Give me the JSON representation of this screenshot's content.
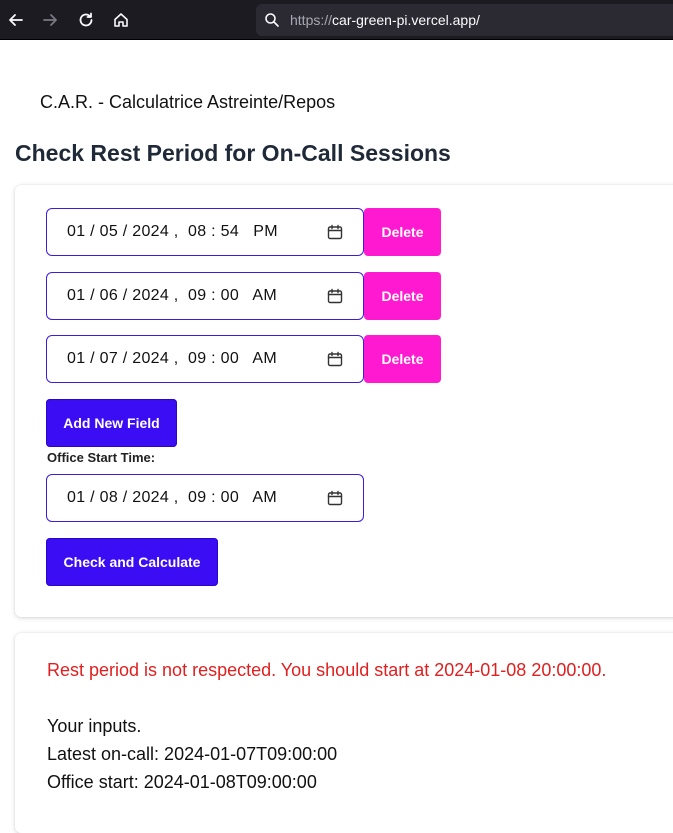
{
  "browser": {
    "url_protocol": "https://",
    "url_host": "car-green-pi.vercel.app/"
  },
  "app": {
    "title": "C.A.R. - Calculatrice Astreinte/Repos",
    "heading": "Check Rest Period for On-Call Sessions"
  },
  "sessions": [
    {
      "value": "01 / 05 / 2024 ,  08 : 54   PM",
      "delete_label": "Delete"
    },
    {
      "value": "01 / 06 / 2024 ,  09 : 00   AM",
      "delete_label": "Delete"
    },
    {
      "value": "01 / 07 / 2024 ,  09 : 00   AM",
      "delete_label": "Delete"
    }
  ],
  "add_field_label": "Add New Field",
  "office": {
    "label": "Office Start Time:",
    "value": "01 / 08 / 2024 ,  09 : 00   AM"
  },
  "check_label": "Check and Calculate",
  "result": {
    "message": "Rest period is not respected. You should start at 2024-01-08 20:00:00.",
    "inputs_heading": "Your inputs.",
    "latest_oncall": "Latest on-call: 2024-01-07T09:00:00",
    "office_start": "Office start: 2024-01-08T09:00:00"
  },
  "colors": {
    "accent_purple": "#3b0df5",
    "delete_pink": "#ff1ad1",
    "error_red": "#e02020"
  }
}
